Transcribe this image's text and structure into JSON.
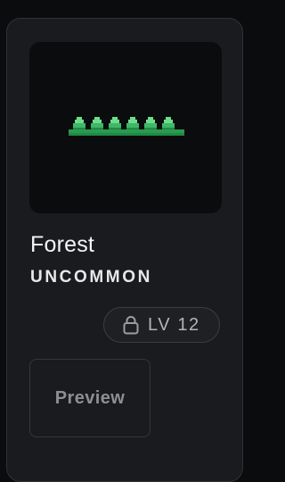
{
  "item": {
    "title": "Forest",
    "rarity": "UNCOMMON",
    "level_label": "LV 12",
    "preview_label": "Preview",
    "thumbnail_icon": "pixel-forest-trees",
    "locked": true
  },
  "colors": {
    "card_bg": "#1a1b1e",
    "card_border": "#2f3237",
    "thumb_bg": "#0b0c0e",
    "tree_light": "#6fdc8c",
    "tree_mid": "#3fb868",
    "tree_dark": "#1f8a45",
    "ground": "#2a9a4e",
    "text_primary": "#f5f5f5",
    "text_muted": "#8d8f93"
  }
}
